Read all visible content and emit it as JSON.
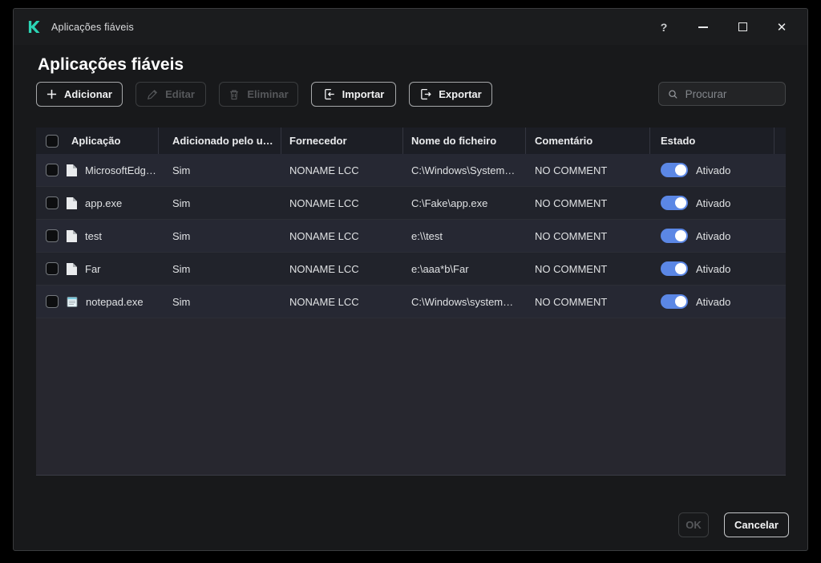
{
  "titlebar": {
    "app_title": "Aplicações fiáveis",
    "help": "?",
    "close": "✕"
  },
  "page_title": "Aplicações fiáveis",
  "toolbar": {
    "add": "Adicionar",
    "edit": "Editar",
    "delete": "Eliminar",
    "import": "Importar",
    "export": "Exportar",
    "search_placeholder": "Procurar"
  },
  "table": {
    "headers": [
      "Aplicação",
      "Adicionado pelo u…",
      "Fornecedor",
      "Nome do ficheiro",
      "Comentário",
      "Estado"
    ],
    "rows": [
      {
        "icon": "file-icon",
        "app": "MicrosoftEdg…",
        "added": "Sim",
        "vendor": "NONAME LCC",
        "path": "C:\\Windows\\System…",
        "comment": "NO COMMENT",
        "status_label": "Ativado",
        "status_on": true
      },
      {
        "icon": "file-icon",
        "app": "app.exe",
        "added": "Sim",
        "vendor": "NONAME LCC",
        "path": "C:\\Fake\\app.exe",
        "comment": "NO COMMENT",
        "status_label": "Ativado",
        "status_on": true
      },
      {
        "icon": "file-icon",
        "app": "test",
        "added": "Sim",
        "vendor": "NONAME LCC",
        "path": "e:\\\\test",
        "comment": "NO COMMENT",
        "status_label": "Ativado",
        "status_on": true
      },
      {
        "icon": "file-icon",
        "app": "Far",
        "added": "Sim",
        "vendor": "NONAME LCC",
        "path": "e:\\aaa*b\\Far",
        "comment": "NO COMMENT",
        "status_label": "Ativado",
        "status_on": true
      },
      {
        "icon": "notepad-icon",
        "app": "notepad.exe",
        "added": "Sim",
        "vendor": "NONAME LCC",
        "path": "C:\\Windows\\system…",
        "comment": "NO COMMENT",
        "status_label": "Ativado",
        "status_on": true
      }
    ]
  },
  "footer": {
    "ok": "OK",
    "cancel": "Cancelar"
  },
  "colors": {
    "toggle_on": "#5B87E5",
    "brand_teal": "#2BD4B4",
    "row_odd": "#262833",
    "row_even": "#21232B"
  }
}
